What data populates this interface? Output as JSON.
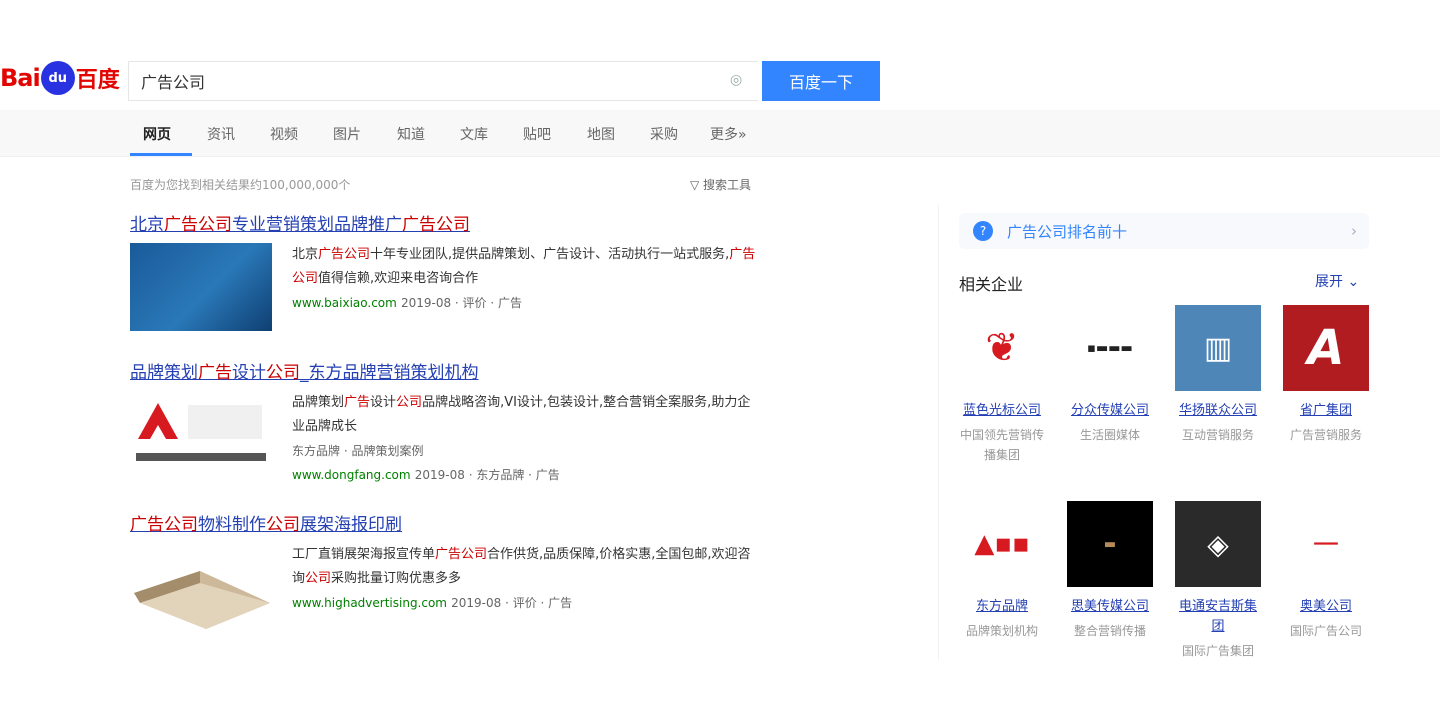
{
  "search": {
    "query": "广告公司",
    "button_label": "百度一下"
  },
  "logo": {
    "left": "Bai",
    "mid": "du",
    "right": "百度"
  },
  "tabs": [
    {
      "label": "网页"
    },
    {
      "label": "资讯"
    },
    {
      "label": "视频"
    },
    {
      "label": "图片"
    },
    {
      "label": "知道"
    },
    {
      "label": "文库"
    },
    {
      "label": "贴吧"
    },
    {
      "label": "地图"
    },
    {
      "label": "采购"
    },
    {
      "label": "更多»"
    }
  ],
  "result_count": "百度为您找到相关结果约100,000,000个",
  "search_tools": "搜索工具",
  "results": [
    {
      "title_parts": [
        "北京",
        "广告公司",
        "专业营销策划品牌推广",
        "广告公司"
      ],
      "text_parts": [
        "北京",
        "广告公司",
        "十年专业团队,提供品牌策划、广告设计、活动执行一站式服务,",
        "广告公司",
        "值得信赖,欢迎来电咨询合作"
      ],
      "url": "www.baixiao.com",
      "meta": "2019-08  ·  评价  ·  广告"
    },
    {
      "title_parts": [
        "品牌策划",
        "广告",
        "设计",
        "公司",
        "_东方品牌营销策划机构"
      ],
      "text_parts": [
        "品牌策划",
        "广告",
        "设计",
        "公司",
        "品牌战略咨询,VI设计,包装设计,整合营销全案服务,助力企业品牌成长"
      ],
      "sub": "东方品牌  ·  品牌策划案例",
      "url": "www.dongfang.com",
      "meta": "2019-08  ·  东方品牌  ·  广告"
    },
    {
      "title_parts": [
        "广告公司",
        "物料制作",
        "公司",
        "展架海报印刷"
      ],
      "text_parts": [
        "工厂直销展架海报宣传单",
        "广告公司",
        "合作供货,品质保障,价格实惠,全国包邮,欢迎咨询",
        "公司",
        "采购批量订购优惠多多"
      ],
      "url": "www.highadvertising.com",
      "meta": "2019-08  ·  评价  ·  广告"
    }
  ],
  "right_panel": {
    "ask_text": "广告公司排名前十",
    "section_title": "相关企业",
    "more_label": "展开",
    "brands": [
      {
        "name": "蓝色光标公司",
        "desc": "中国领先营销传播集团"
      },
      {
        "name": "分众传媒公司",
        "desc": "生活圈媒体"
      },
      {
        "name": "华扬联众公司",
        "desc": "互动营销服务"
      },
      {
        "name": "省广集团",
        "desc": "广告营销服务"
      },
      {
        "name": "东方品牌",
        "desc": "品牌策划机构"
      },
      {
        "name": "思美传媒公司",
        "desc": "整合营销传播"
      },
      {
        "name": "电通安吉斯集团",
        "desc": "国际广告集团"
      },
      {
        "name": "奥美公司",
        "desc": "国际广告公司"
      }
    ]
  },
  "colors": {
    "accent": "#3385ff",
    "link": "#2440b3",
    "highlight": "#c00000",
    "url": "#008000"
  }
}
